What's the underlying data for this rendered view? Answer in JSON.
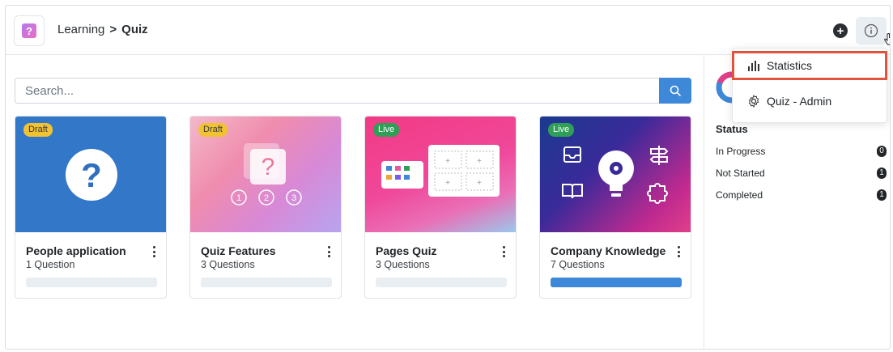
{
  "header": {
    "breadcrumb_parent": "Learning",
    "breadcrumb_separator": ">",
    "breadcrumb_current": "Quiz",
    "app_icon": "quiz-question-icon",
    "plus_button_icon": "plus-circle-icon",
    "info_button_icon": "info-circle-icon"
  },
  "search": {
    "placeholder": "Search...",
    "button_icon": "search-icon"
  },
  "cards": [
    {
      "status": "Draft",
      "title": "People application",
      "subtitle": "1 Question",
      "progress": 0
    },
    {
      "status": "Draft",
      "title": "Quiz Features",
      "subtitle": "3 Questions",
      "progress": 0
    },
    {
      "status": "Live",
      "title": "Pages Quiz",
      "subtitle": "3 Questions",
      "progress": 0
    },
    {
      "status": "Live",
      "title": "Company Knowledge",
      "subtitle": "7 Questions",
      "progress": 1
    }
  ],
  "menu": {
    "items": [
      {
        "label": "Statistics",
        "icon": "bar-chart-icon",
        "highlighted": true
      },
      {
        "label": "Quiz - Admin",
        "icon": "gear-icon",
        "highlighted": false
      }
    ]
  },
  "status_panel": {
    "title": "Status",
    "rows": [
      {
        "label": "In Progress",
        "count": "0"
      },
      {
        "label": "Not Started",
        "count": "1"
      },
      {
        "label": "Completed",
        "count": "1"
      }
    ]
  },
  "colors": {
    "accent": "#3d88d8",
    "draft_badge": "#f1c232",
    "live_badge": "#2f9e57",
    "highlight_outline": "#e0533e"
  }
}
